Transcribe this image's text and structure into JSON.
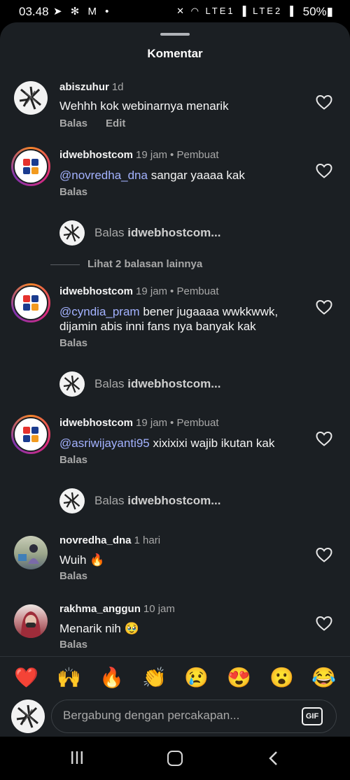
{
  "status_bar": {
    "time": "03.48",
    "left_icons": "➤ ✻ M •",
    "right_icons": "✕ ◠ LTE1 ▐ LTE2 ▐",
    "battery": "50%▮"
  },
  "sheet": {
    "title": "Komentar"
  },
  "comments": [
    {
      "username": "abiszuhur",
      "time": "1d",
      "badge": "",
      "mention": "",
      "text": "Wehhh kok webinarnya menarik",
      "actions": [
        "Balas",
        "Edit"
      ]
    },
    {
      "username": "idwebhostcom",
      "time": "19 jam",
      "badge": "• Pembuat",
      "mention": "@novredha_dna",
      "text": " sangar yaaaa kak",
      "actions": [
        "Balas"
      ]
    },
    {
      "username": "idwebhostcom",
      "time": "19 jam",
      "badge": "• Pembuat",
      "mention": "@cyndia_pram",
      "text": " bener jugaaaa wwkkwwk, dijamin abis inni fans nya banyak kak",
      "actions": [
        "Balas"
      ]
    },
    {
      "username": "idwebhostcom",
      "time": "19 jam",
      "badge": "• Pembuat",
      "mention": "@asriwijayanti95",
      "text": " xixixixi wajib ikutan kak",
      "actions": [
        "Balas"
      ]
    },
    {
      "username": "novredha_dna",
      "time": "1 hari",
      "badge": "",
      "mention": "",
      "text": "Wuih 🔥",
      "actions": [
        "Balas"
      ]
    },
    {
      "username": "rakhma_anggun",
      "time": "10 jam",
      "badge": "",
      "mention": "",
      "text": "Menarik nih 🥹",
      "actions": [
        "Balas"
      ]
    }
  ],
  "reply_prompt": {
    "prefix": "Balas ",
    "target": "idwebhostcom..."
  },
  "view_more": "Lihat 2 balasan lainnya",
  "emoji_bar": [
    "❤️",
    "🙌",
    "🔥",
    "👏",
    "😢",
    "😍",
    "😮",
    "😂"
  ],
  "composer": {
    "placeholder": "Bergabung dengan percakapan...",
    "gif_label": "GIF"
  },
  "icons": {
    "like": "heart-icon",
    "nav": [
      "recents-icon",
      "home-icon",
      "back-icon"
    ]
  },
  "colors": {
    "background": "#1b1f23",
    "mention": "#a3b2ff",
    "muted_text": "#a8a8a8"
  }
}
